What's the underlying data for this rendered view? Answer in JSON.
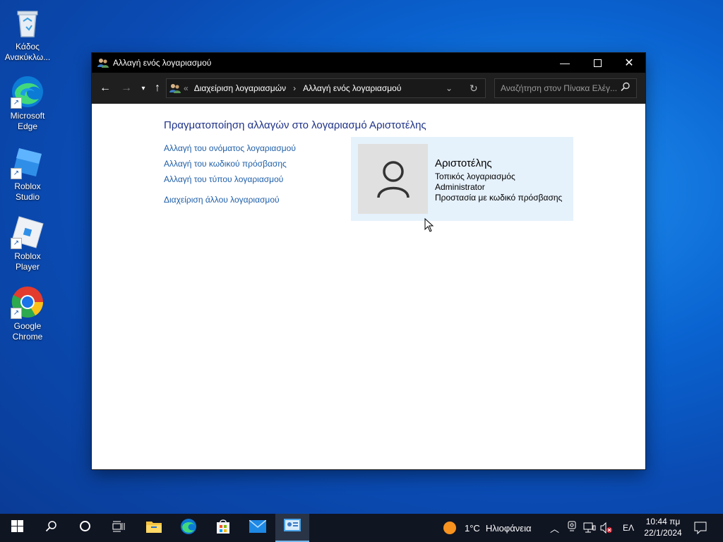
{
  "desktop": {
    "icons": [
      {
        "label": "Κάδος Ανακύκλω..."
      },
      {
        "label": "Microsoft Edge"
      },
      {
        "label": "Roblox Studio"
      },
      {
        "label": "Roblox Player"
      },
      {
        "label": "Google Chrome"
      }
    ]
  },
  "window": {
    "title": "Αλλαγή ενός λογαριασμού",
    "address": {
      "separator": "«",
      "crumb1": "Διαχείριση λογαριασμών",
      "crumb2": "Αλλαγή ενός λογαριασμού"
    },
    "search_placeholder": "Αναζήτηση στον Πίνακα Ελέγ...",
    "heading": "Πραγματοποίηση αλλαγών στο λογαριασμό Αριστοτέλης",
    "links": [
      "Αλλαγή του ονόματος λογαριασμού",
      "Αλλαγή του κωδικού πρόσβασης",
      "Αλλαγή του τύπου λογαριασμού",
      "Διαχείριση άλλου λογαριασμού"
    ],
    "account": {
      "name": "Αριστοτέλης",
      "type": "Τοπικός λογαριασμός",
      "role": "Administrator",
      "protection": "Προστασία με κωδικό πρόσβασης"
    }
  },
  "taskbar": {
    "weather_temp": "1°C",
    "weather_desc": "Ηλιοφάνεια",
    "language": "ΕΛ",
    "time": "10:44 πμ",
    "date": "22/1/2024"
  }
}
